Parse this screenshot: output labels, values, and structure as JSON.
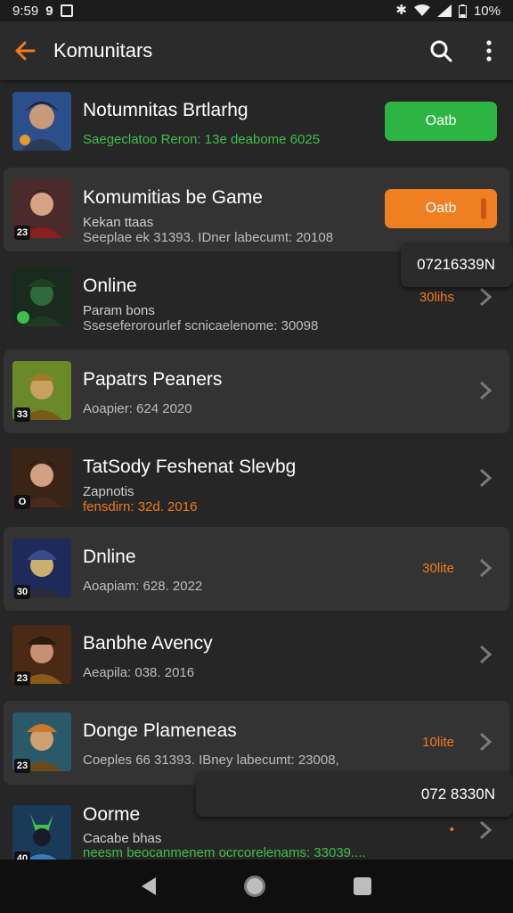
{
  "status_bar": {
    "time": "9:59",
    "left_glyph": "9",
    "battery": "10%",
    "icons": [
      "bluetooth-icon",
      "wifi-icon",
      "signal-icon",
      "battery-icon"
    ]
  },
  "appbar": {
    "title": "Komunitars",
    "back_icon": "arrow-left-icon",
    "search_icon": "search-icon",
    "menu_icon": "more-vertical-icon"
  },
  "colors": {
    "accent": "#f07b1f",
    "green": "#2db543",
    "background": "#262626",
    "row_highlight": "#333333"
  },
  "items": [
    {
      "name": "Notumnitas Brtlarhg",
      "line2": "",
      "line3": "Saegeclatoo Reron: 13e deabome 6025",
      "line3_color": "green",
      "badge": "",
      "action": {
        "type": "button",
        "label": "Oatb",
        "color": "green"
      },
      "highlight": false
    },
    {
      "name": "Komumitias be Game",
      "line2": "Kekan ttaas",
      "line3": "Seeplae ek 31393. IDner labecumt: 20108",
      "badge": "23",
      "action": {
        "type": "button",
        "label": "Oatb",
        "color": "orange"
      },
      "highlight": true
    },
    {
      "name": "Online",
      "line2": "Param bons",
      "line3": "Sseseferorourlef scnicaelenome: 30098",
      "badge": "",
      "action": {
        "type": "status",
        "label": "30lihs"
      },
      "highlight": false
    },
    {
      "name": "Papatrs Peaners",
      "line2": "",
      "line3": "Aoapier: 624 2020",
      "badge": "33",
      "action": {
        "type": "chevron",
        "label": ""
      },
      "highlight": true
    },
    {
      "name": "TatSody Feshenat Slevbg",
      "line2": "Zapnotis",
      "line3": "fensdirn: 32d. 2016",
      "badge": "O",
      "action": {
        "type": "chevron",
        "label": ""
      },
      "highlight": false
    },
    {
      "name": "Dnline",
      "line2": "",
      "line3": "Aoapiam: 628. 2022",
      "badge": "30",
      "action": {
        "type": "status",
        "label": "30lite"
      },
      "highlight": true
    },
    {
      "name": "Banbhe Avency",
      "line2": "",
      "line3": "Aeapila: 038. 2016",
      "badge": "23",
      "action": {
        "type": "chevron",
        "label": ""
      },
      "highlight": false
    },
    {
      "name": "Donge Plameneas",
      "line2": "",
      "line3": "Coeples 66 31393. IBney labecumt: 23008,",
      "badge": "23",
      "action": {
        "type": "status",
        "label": "10lite"
      },
      "highlight": true
    },
    {
      "name": "Oorme",
      "line2": "Cacabe bhas",
      "line3": "neesm beocanmenem ocrcorelenams: 33039....",
      "badge": "40",
      "action": {
        "type": "status",
        "label": "•"
      },
      "highlight": false
    }
  ],
  "popups": [
    {
      "text": "07216339N"
    },
    {
      "text": "072 8330N"
    }
  ],
  "navbar": {
    "back": "nav-back-icon",
    "home": "nav-home-icon",
    "recent": "nav-recents-icon"
  }
}
